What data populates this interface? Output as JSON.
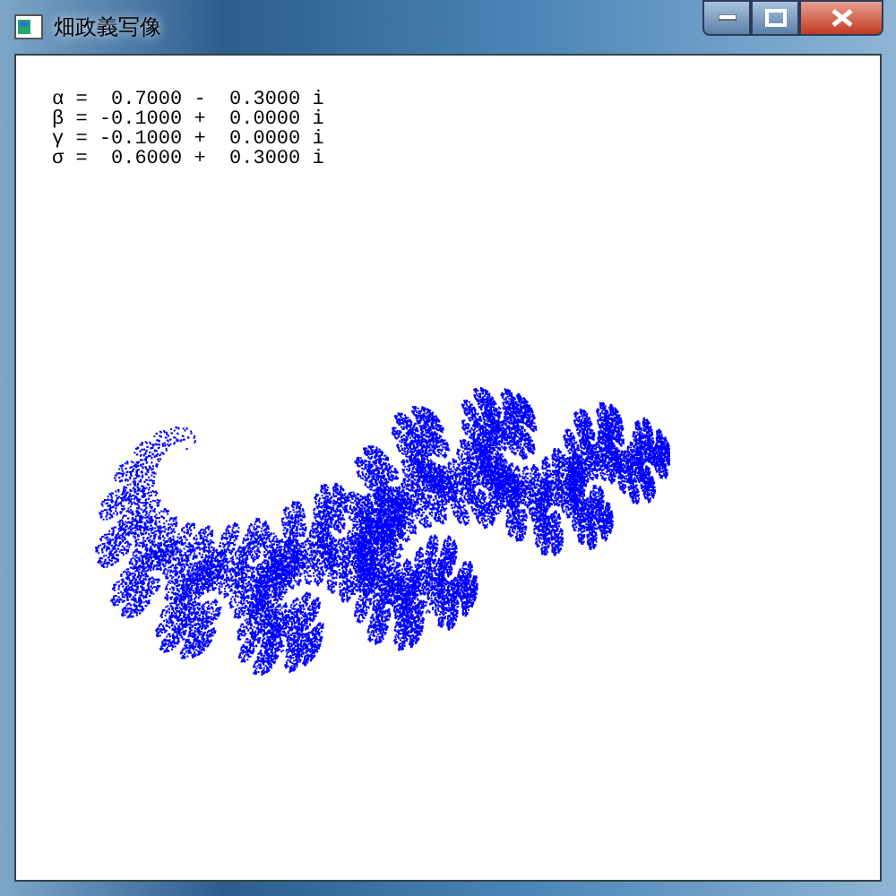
{
  "window": {
    "title": "畑政義写像"
  },
  "parameters": [
    "α =  0.7000 -  0.3000 i",
    "β = -0.1000 +  0.0000 i",
    "γ = -0.1000 +  0.0000 i",
    "σ =  0.6000 +  0.3000 i"
  ]
}
